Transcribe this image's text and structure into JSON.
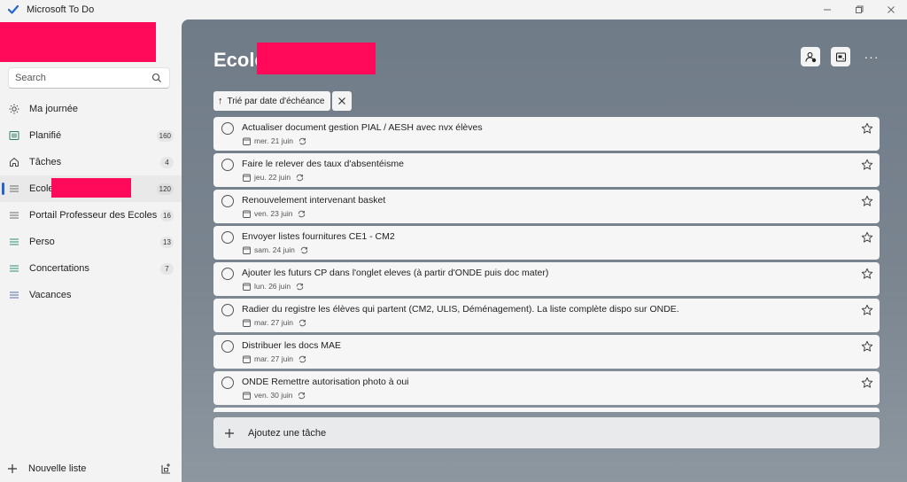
{
  "window": {
    "title": "Microsoft To Do",
    "controls": [
      "minimize",
      "restore",
      "close"
    ]
  },
  "sidebar": {
    "search_placeholder": "Search",
    "items": [
      {
        "label": "Ma journée",
        "count": "",
        "icon": "sun-icon"
      },
      {
        "label": "Planifié",
        "count": "160",
        "icon": "calendar-grid-icon"
      },
      {
        "label": "Tâches",
        "count": "4",
        "icon": "home-icon"
      },
      {
        "label": "Ecole",
        "count": "120",
        "icon": "list-icon",
        "active": true
      },
      {
        "label": "Portail Professeur des Ecoles",
        "count": "16",
        "icon": "list-icon"
      },
      {
        "label": "Perso",
        "count": "13",
        "icon": "list-icon"
      },
      {
        "label": "Concertations",
        "count": "7",
        "icon": "list-icon"
      },
      {
        "label": "Vacances",
        "count": "",
        "icon": "list-icon"
      }
    ],
    "new_list_label": "Nouvelle liste"
  },
  "main": {
    "title": "Ecole",
    "sort_label": "Trié par date d'échéance",
    "tasks": [
      {
        "title": "Actualiser document gestion PIAL / AESH avec nvx élèves",
        "due": "mer. 21 juin"
      },
      {
        "title": "Faire le relever des taux d'absentéisme",
        "due": "jeu. 22 juin"
      },
      {
        "title": "Renouvelement intervenant basket",
        "due": "ven. 23 juin"
      },
      {
        "title": "Envoyer listes fournitures CE1 - CM2",
        "due": "sam. 24 juin"
      },
      {
        "title": "Ajouter les futurs CP dans l'onglet eleves (à partir d'ONDE puis doc mater)",
        "due": "lun. 26 juin"
      },
      {
        "title": "Radier du registre les élèves qui partent (CM2, ULIS, Déménagement). La liste complète dispo sur ONDE.",
        "due": "mar. 27 juin"
      },
      {
        "title": "Distribuer les docs MAE",
        "due": "mar. 27 juin"
      },
      {
        "title": "ONDE Remettre autorisation photo à oui",
        "due": "ven. 30 juin"
      }
    ],
    "add_task_label": "Ajoutez une tâche"
  },
  "colors": {
    "accent": "#2564cf",
    "redaction": "#ff0a5a",
    "main_background": "#76818c"
  }
}
